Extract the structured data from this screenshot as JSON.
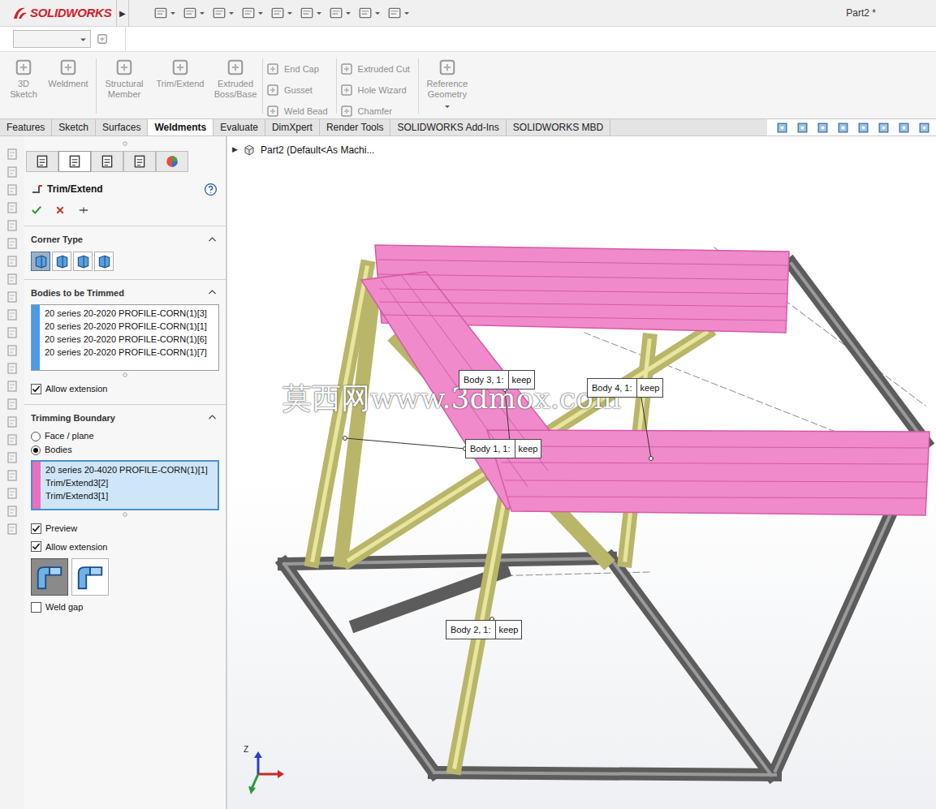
{
  "titlebar": {
    "logo": "SOLIDWORKS",
    "menu_arrow": "▶",
    "document": "Part2 *"
  },
  "ribbon": {
    "groups": [
      {
        "kind": "large",
        "items": [
          {
            "label": "3D Sketch",
            "disabled": true
          },
          {
            "label": "Weldment",
            "disabled": true
          }
        ]
      },
      {
        "kind": "large",
        "items": [
          {
            "label": "Structural Member",
            "disabled": true
          },
          {
            "label": "Trim/Extend",
            "disabled": true
          },
          {
            "label": "Extruded Boss/Base",
            "disabled": true
          }
        ]
      },
      {
        "kind": "stack",
        "items": [
          {
            "label": "End Cap",
            "disabled": true
          },
          {
            "label": "Gusset",
            "disabled": true
          },
          {
            "label": "Weld Bead",
            "disabled": true
          }
        ]
      },
      {
        "kind": "stack",
        "items": [
          {
            "label": "Extruded Cut",
            "disabled": true
          },
          {
            "label": "Hole Wizard",
            "disabled": true
          },
          {
            "label": "Chamfer",
            "disabled": true
          }
        ]
      },
      {
        "kind": "large",
        "items": [
          {
            "label": "Reference Geometry",
            "disabled": true
          }
        ]
      }
    ]
  },
  "tabs": [
    {
      "label": "Features",
      "selected": false
    },
    {
      "label": "Sketch",
      "selected": false
    },
    {
      "label": "Surfaces",
      "selected": false
    },
    {
      "label": "Weldments",
      "selected": true
    },
    {
      "label": "Evaluate",
      "selected": false
    },
    {
      "label": "DimXpert",
      "selected": false
    },
    {
      "label": "Render Tools",
      "selected": false
    },
    {
      "label": "SOLIDWORKS Add-Ins",
      "selected": false
    },
    {
      "label": "SOLIDWORKS MBD",
      "selected": false
    }
  ],
  "manager_tabs": [
    {
      "selected": false
    },
    {
      "selected": true
    },
    {
      "selected": false
    },
    {
      "selected": false
    },
    {
      "selected": false
    }
  ],
  "property_manager": {
    "title": "Trim/Extend",
    "corner_type": {
      "title": "Corner Type",
      "options": [
        {
          "selected": true
        },
        {
          "selected": false
        },
        {
          "selected": false
        },
        {
          "selected": false
        }
      ]
    },
    "bodies_to_be_trimmed": {
      "title": "Bodies to be Trimmed",
      "items": [
        "20 series 20-2020 PROFILE-CORN(1)[3]",
        "20 series 20-2020 PROFILE-CORN(1)[1]",
        "20 series 20-2020 PROFILE-CORN(1)[6]",
        "20 series 20-2020 PROFILE-CORN(1)[7]"
      ],
      "allow_extension": {
        "label": "Allow extension",
        "checked": true
      }
    },
    "trimming_boundary": {
      "title": "Trimming Boundary",
      "radios": [
        {
          "label": "Face / plane",
          "selected": false
        },
        {
          "label": "Bodies",
          "selected": true
        }
      ],
      "items": [
        "20 series 20-4020 PROFILE-CORN(1)[1]",
        "Trim/Extend3[2]",
        "Trim/Extend3[1]"
      ],
      "preview": {
        "label": "Preview",
        "checked": true
      },
      "allow_extension": {
        "label": "Allow extension",
        "checked": true
      },
      "trim_options": [
        {
          "selected": true
        },
        {
          "selected": false
        }
      ],
      "weld_gap": {
        "label": "Weld gap",
        "checked": false
      }
    }
  },
  "tree": {
    "expander": "▶",
    "label": "Part2  (Default<As Machi..."
  },
  "callouts": [
    {
      "label": "Body 3,  1:",
      "action": "keep"
    },
    {
      "label": "Body 4,  1:",
      "action": "keep"
    },
    {
      "label": "Body 1,  1:",
      "action": "keep"
    },
    {
      "label": "Body 2,  1:",
      "action": "keep"
    }
  ],
  "watermark": "莫西网www.3dmox.com",
  "triad": {
    "z": "Z"
  }
}
